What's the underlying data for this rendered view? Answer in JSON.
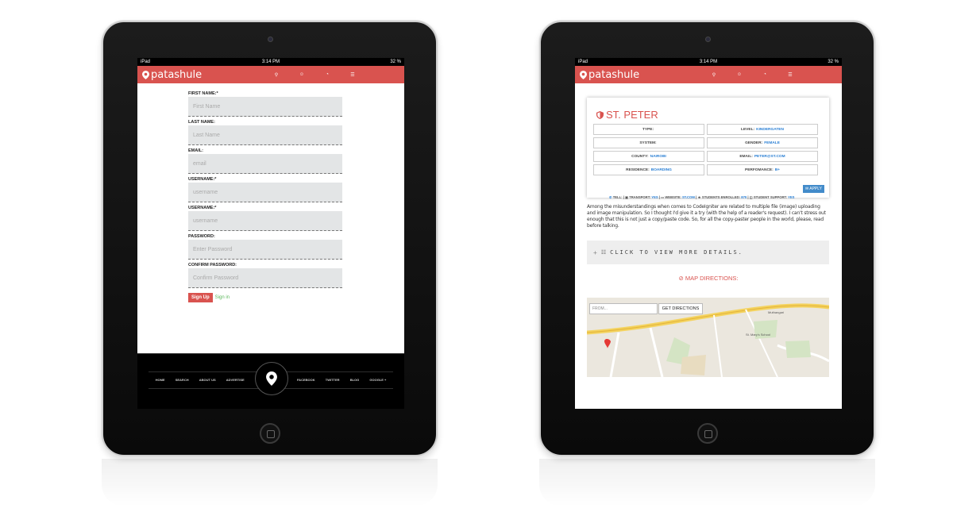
{
  "colors": {
    "brand": "#d9534f",
    "link_blue": "#2a7fd4",
    "signin_green": "#5cb85c",
    "apply_blue": "#428bca"
  },
  "status_bar": {
    "carrier": "iPad",
    "time": "3:14 PM",
    "battery": "32 %"
  },
  "brand": {
    "logo_text": "patashule",
    "icons": [
      "search-icon",
      "user-icon",
      "rss-icon",
      "menu-icon"
    ]
  },
  "signup_form": {
    "fields": [
      {
        "label": "FIRST NAME:*",
        "placeholder": "First Name"
      },
      {
        "label": "LAST NAME:",
        "placeholder": "Last Name"
      },
      {
        "label": "EMAIL:",
        "placeholder": "email"
      },
      {
        "label": "USERNAME:*",
        "placeholder": "username"
      },
      {
        "label": "USERNAME:*",
        "placeholder": "username"
      },
      {
        "label": "PASSWORD:",
        "placeholder": "Enter Password"
      },
      {
        "label": "CONFIRM PASSWORD:",
        "placeholder": "Confirm Password"
      }
    ],
    "signup_label": "Sign Up",
    "signin_label": "Sign in"
  },
  "footer": {
    "links_left": [
      "HOME",
      "SEARCH",
      "ABOUT US",
      "ADVERTISE"
    ],
    "links_right": [
      "FACEBOOK",
      "TWITTER",
      "BLOG",
      "GOOGLE +"
    ]
  },
  "school": {
    "name": "ST. PETER",
    "rows": [
      [
        {
          "label": "TYPE:",
          "value": ""
        },
        {
          "label": "LEVEL:",
          "value": "KINDERGATEN"
        }
      ],
      [
        {
          "label": "SYSTEM:",
          "value": ""
        },
        {
          "label": "GENDER:",
          "value": "FEMALE"
        }
      ],
      [
        {
          "label": "COUNTY:",
          "value": "NAIROBI"
        },
        {
          "label": "EMAIL:",
          "value": "PETER@ST.COM"
        }
      ],
      [
        {
          "label": "RESIDENCE:",
          "value": "BOARDING"
        },
        {
          "label": "PERFOMANCE:",
          "value": "B+"
        }
      ]
    ],
    "apply_label": "APPLY",
    "meta": {
      "tell": "TELL:",
      "transport_label": "TRANSPORT:",
      "transport_value": "YES",
      "website_label": "WEBSITE:",
      "website_value": "ST.COM",
      "students_label": "STUDENTS ENROLLED:",
      "students_value": "870",
      "support_label": "STUDENT SUPPORT:",
      "support_value": "YES"
    }
  },
  "description": "Among the misunderstandings when comes to CodeIgniter are related to multiple file (image) uploading and image manipulation. So I thought I'd give it a try (with the help of a reader's request). I can't stress out enough that this is not just a copy/paste code. So, for all the copy-paster people in the world, please, read before talking.",
  "details_toggle": {
    "symbol": "+",
    "label": "CLICK TO VIEW MORE DETAILS."
  },
  "map": {
    "heading": "MAP DIRECTIONS:",
    "from_placeholder": "FROM...",
    "get_directions_label": "GET DIRECTIONS",
    "place_labels": [
      "St. Mary's School",
      "Muthangari"
    ]
  }
}
